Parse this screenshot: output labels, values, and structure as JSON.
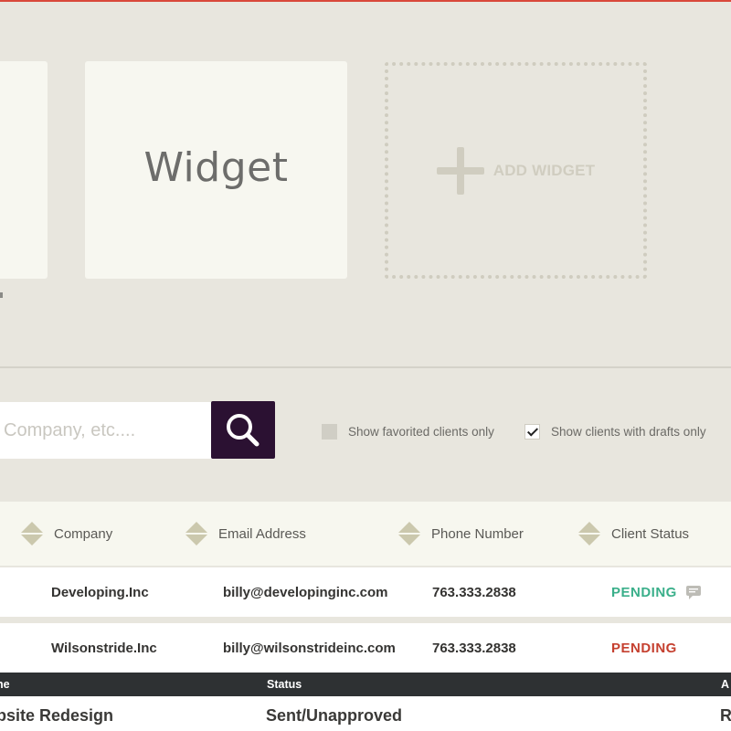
{
  "widgets": {
    "main_title": "Widget",
    "add_label": "ADD WIDGET"
  },
  "search": {
    "placeholder": "Company, etc...."
  },
  "filters": {
    "favorited": {
      "label": "Show favorited clients only",
      "checked": false
    },
    "drafts": {
      "label": "Show clients with drafts only",
      "checked": true
    }
  },
  "table": {
    "columns": [
      "Company",
      "Email Address",
      "Phone Number",
      "Client Status"
    ],
    "rows": [
      {
        "company": "Developing.Inc",
        "email": "billy@developinginc.com",
        "phone": "763.333.2838",
        "status": "PENDING",
        "status_color": "#3aaf8a",
        "has_comment": true
      },
      {
        "company": "Wilsonstride.Inc",
        "email": "billy@wilsonstrideinc.com",
        "phone": "763.333.2838",
        "status": "PENDING",
        "status_color": "#c5402f",
        "has_comment": false
      }
    ]
  },
  "subtable": {
    "columns": [
      "ne",
      "Status",
      "A"
    ],
    "row": {
      "name": "bsite Redesign",
      "status": "Sent/Unapproved",
      "extra": "R"
    }
  },
  "colors": {
    "accent_line": "#d9493b",
    "search_button": "#2b1132",
    "pending_green": "#3aaf8a",
    "pending_red": "#c5402f"
  }
}
